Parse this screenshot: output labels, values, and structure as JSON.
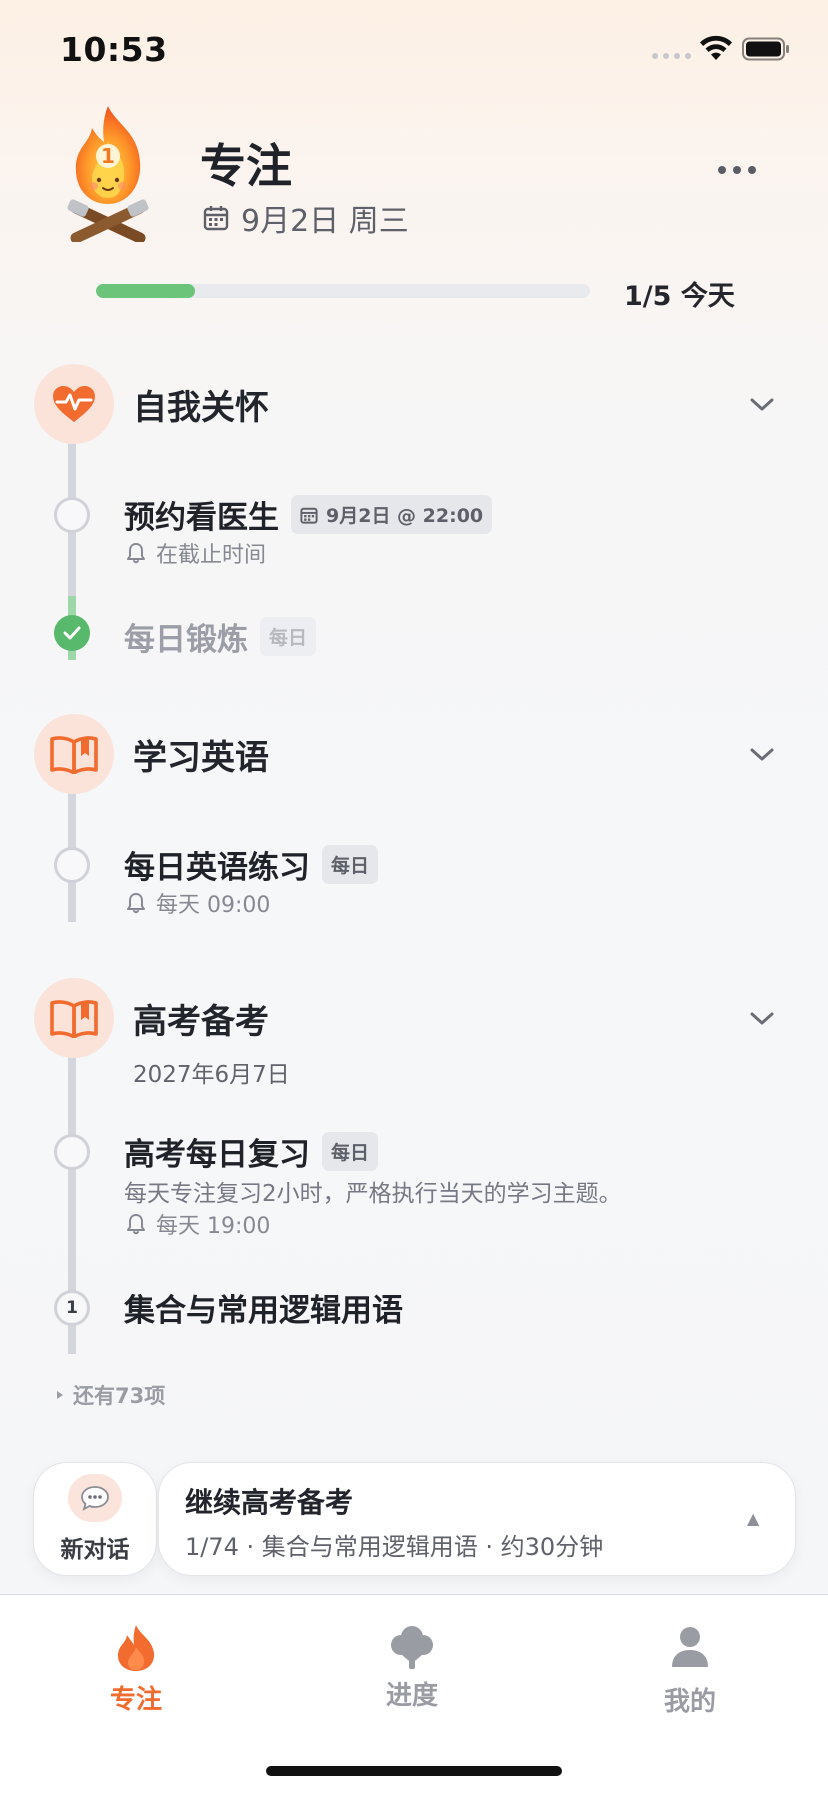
{
  "status_bar": {
    "time": "10:53"
  },
  "header": {
    "title": "专注",
    "date": "9月2日 周三",
    "progress_fraction": 0.2,
    "progress_text": "1/5 今天",
    "mascot_badge": "1"
  },
  "groups": [
    {
      "title": "自我关怀",
      "icon": "heart-pulse-icon",
      "tasks": [
        {
          "title": "预约看医生",
          "chip": "9月2日 @ 22:00",
          "sub": "在截止时间",
          "done": false
        },
        {
          "title": "每日锻炼",
          "chip": "每日",
          "done": true
        }
      ]
    },
    {
      "title": "学习英语",
      "icon": "book-icon",
      "tasks": [
        {
          "title": "每日英语练习",
          "chip": "每日",
          "sub": "每天 09:00",
          "done": false
        }
      ]
    },
    {
      "title": "高考备考",
      "icon": "book-icon",
      "date": "2027年6月7日",
      "tasks": [
        {
          "title": "高考每日复习",
          "chip": "每日",
          "note": "每天专注复习2小时，严格执行当天的学习主题。",
          "sub": "每天 19:00",
          "done": false
        },
        {
          "title": "集合与常用逻辑用语",
          "number": "1",
          "done": false
        }
      ],
      "more": "还有73项"
    }
  ],
  "action_bar": {
    "new_chat_label": "新对话",
    "continue_title": "继续高考备考",
    "continue_sub": "1/74 · 集合与常用逻辑用语 · 约30分钟",
    "caret": "▲"
  },
  "tabs": [
    {
      "label": "专注",
      "icon": "flame-icon",
      "active": true
    },
    {
      "label": "进度",
      "icon": "tree-icon",
      "active": false
    },
    {
      "label": "我的",
      "icon": "person-icon",
      "active": false
    }
  ],
  "colors": {
    "accent": "#f26b2f",
    "done_green": "#58b86b",
    "inactive_tab": "#9a9ca3"
  }
}
